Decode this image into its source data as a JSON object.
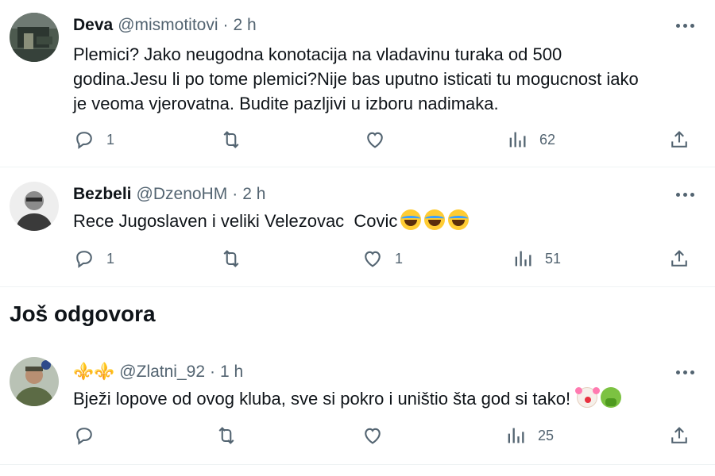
{
  "tweets": [
    {
      "name": "Deva",
      "handle": "@mismotitovi",
      "separator": "·",
      "time": "2 h",
      "text_lines": [
        "Plemici? Jako neugodna konotacija na vladavinu turaka od 500",
        "godina.Jesu li po tome plemici?Nije bas uputno isticati tu mogucnost iako",
        "je veoma vjerovatna. Budite pazljivi u izboru nadimaka."
      ],
      "replies": "1",
      "retweets": "",
      "likes": "",
      "views": "62"
    },
    {
      "name": "Bezbeli",
      "handle": "@DzenoHM",
      "separator": "·",
      "time": "2 h",
      "text": "Rece Jugoslaven i veliki Velezovac  Covic",
      "emojis": [
        "face-with-tears-of-joy",
        "face-with-tears-of-joy",
        "face-with-tears-of-joy"
      ],
      "replies": "1",
      "retweets": "",
      "likes": "1",
      "views": "51"
    },
    {
      "name": "⚜️⚜️",
      "handle": "@Zlatni_92",
      "separator": "·",
      "time": "1 h",
      "text": "Bježi lopove od ovog kluba, sve si pokro i uništio šta god si tako!",
      "emojis": [
        "clown-face",
        "nauseated-face"
      ],
      "replies": "",
      "retweets": "",
      "likes": "",
      "views": "25"
    }
  ],
  "section_title": "Još odgovora",
  "colors": {
    "text": "#0f1419",
    "secondary": "#536471",
    "divider": "#eff3f4",
    "fleur": "#8e6bbf"
  },
  "icons": [
    "reply-icon",
    "retweet-icon",
    "like-icon",
    "views-icon",
    "share-icon",
    "more-icon"
  ]
}
